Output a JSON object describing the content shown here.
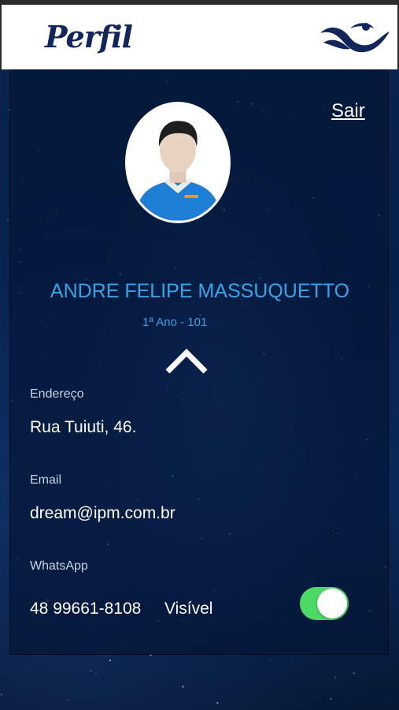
{
  "header": {
    "title": "Perfil",
    "logo_icon": "wave-logo-icon"
  },
  "actions": {
    "logout_label": "Sair"
  },
  "profile": {
    "avatar_icon": "user-avatar-icon",
    "name": "ANDRE FELIPE MASSUQUETTO",
    "class": "1ª Ano - 101",
    "collapse_icon": "chevron-up-icon"
  },
  "fields": {
    "address": {
      "label": "Endereço",
      "value": "Rua Tuiuti, 46."
    },
    "email": {
      "label": "Email",
      "value": "dream@ipm.com.br"
    },
    "whatsapp": {
      "label": "WhatsApp",
      "value": "48 99661-8108",
      "visibility_label": "Visível",
      "visible": true
    }
  },
  "colors": {
    "accent_blue": "#3aa3e8",
    "toggle_on": "#4cd964",
    "brand_navy": "#13265c"
  }
}
